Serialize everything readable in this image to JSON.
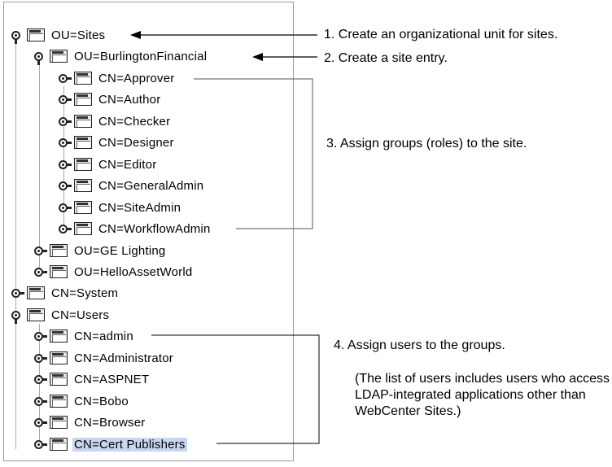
{
  "tree": {
    "nodes": [
      {
        "label": "OU=Sites",
        "level": 0,
        "state": "expanded"
      },
      {
        "label": "OU=BurlingtonFinancial",
        "level": 1,
        "state": "expanded"
      },
      {
        "label": "CN=Approver",
        "level": 2,
        "state": "collapsed"
      },
      {
        "label": "CN=Author",
        "level": 2,
        "state": "collapsed"
      },
      {
        "label": "CN=Checker",
        "level": 2,
        "state": "collapsed"
      },
      {
        "label": "CN=Designer",
        "level": 2,
        "state": "collapsed"
      },
      {
        "label": "CN=Editor",
        "level": 2,
        "state": "collapsed"
      },
      {
        "label": "CN=GeneralAdmin",
        "level": 2,
        "state": "collapsed"
      },
      {
        "label": "CN=SiteAdmin",
        "level": 2,
        "state": "collapsed"
      },
      {
        "label": "CN=WorkflowAdmin",
        "level": 2,
        "state": "collapsed"
      },
      {
        "label": "OU=GE Lighting",
        "level": 1,
        "state": "collapsed"
      },
      {
        "label": "OU=HelloAssetWorld",
        "level": 1,
        "state": "collapsed"
      },
      {
        "label": "CN=System",
        "level": 0,
        "state": "collapsed"
      },
      {
        "label": "CN=Users",
        "level": 0,
        "state": "expanded"
      },
      {
        "label": "CN=admin",
        "level": 1,
        "state": "collapsed"
      },
      {
        "label": "CN=Administrator",
        "level": 1,
        "state": "collapsed"
      },
      {
        "label": "CN=ASPNET",
        "level": 1,
        "state": "collapsed"
      },
      {
        "label": "CN=Bobo",
        "level": 1,
        "state": "collapsed"
      },
      {
        "label": "CN=Browser",
        "level": 1,
        "state": "collapsed"
      },
      {
        "label": "CN=Cert Publishers",
        "level": 1,
        "state": "collapsed",
        "selected": true
      }
    ]
  },
  "annotations": {
    "step1": "1. Create an organizational unit for sites.",
    "step2": "2. Create a site entry.",
    "step3": "3. Assign groups (roles) to the site.",
    "step4": "4.  Assign users to the groups.",
    "step4_note": "(The list of users includes users who access LDAP-integrated applications other than WebCenter Sites.)"
  },
  "colors": {
    "selection": "#c9d6f1",
    "panel_border": "#9a9a9a"
  }
}
